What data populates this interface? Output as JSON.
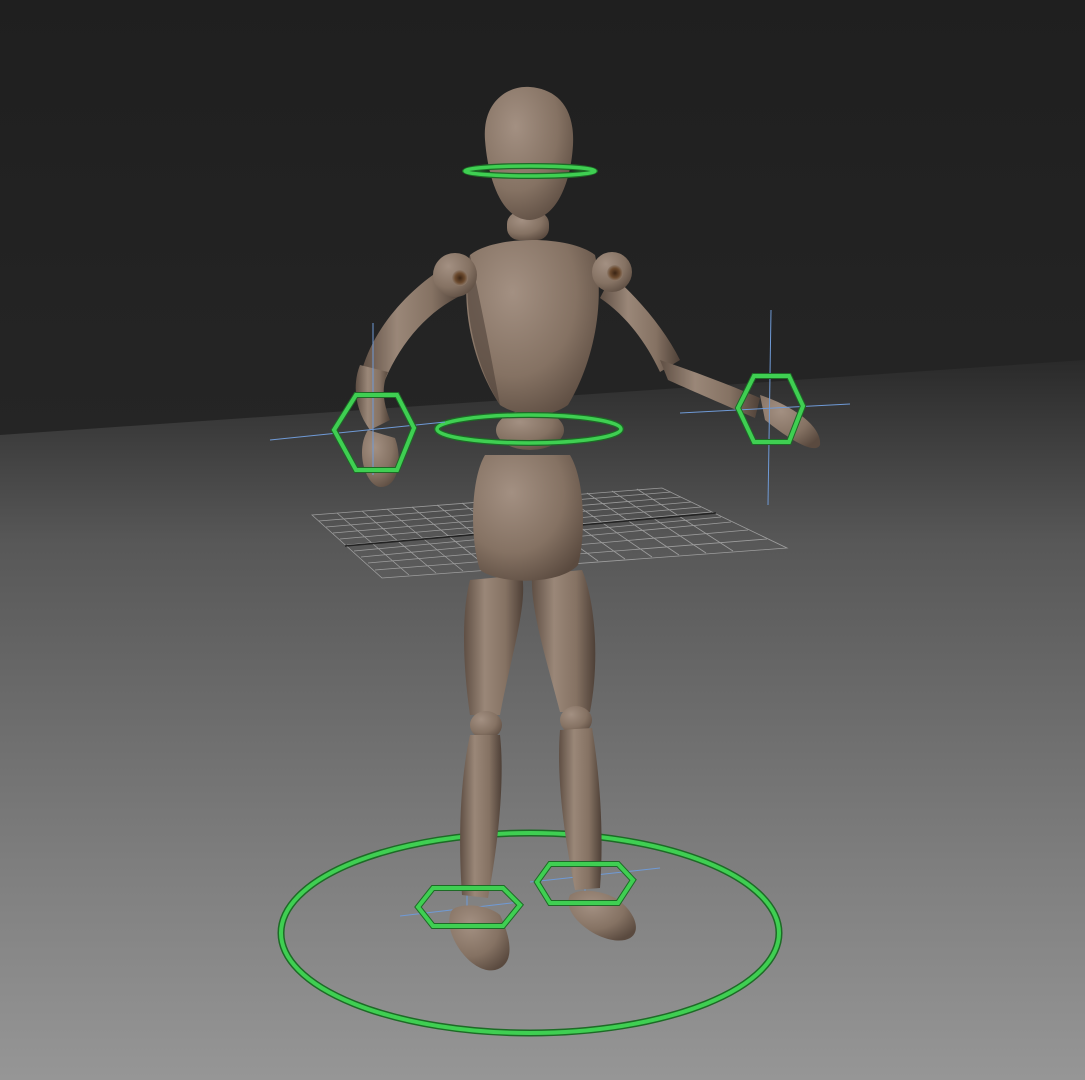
{
  "viewport": {
    "view": "3d-perspective",
    "background_top": "#262626",
    "floor_near": "#8c8c8c",
    "floor_far": "#3a3a3a"
  },
  "scene": {
    "model": "wooden-mannequin",
    "wood_color": "#8a7768",
    "wood_shadow": "#5a4a3f",
    "joint_color": "#5c3a22"
  },
  "rig": {
    "control_color": "#39c24a",
    "controls": [
      {
        "name": "head-control",
        "shape": "ring"
      },
      {
        "name": "waist-control",
        "shape": "ring"
      },
      {
        "name": "left-hand-ik-control",
        "shape": "hexagon"
      },
      {
        "name": "right-hand-ik-control",
        "shape": "hexagon"
      },
      {
        "name": "left-foot-ik-control",
        "shape": "hexagon"
      },
      {
        "name": "right-foot-ik-control",
        "shape": "hexagon"
      },
      {
        "name": "root-control",
        "shape": "circle"
      }
    ],
    "locator_color": "#5f8fd0",
    "grid_color": "#b0b0b0"
  }
}
